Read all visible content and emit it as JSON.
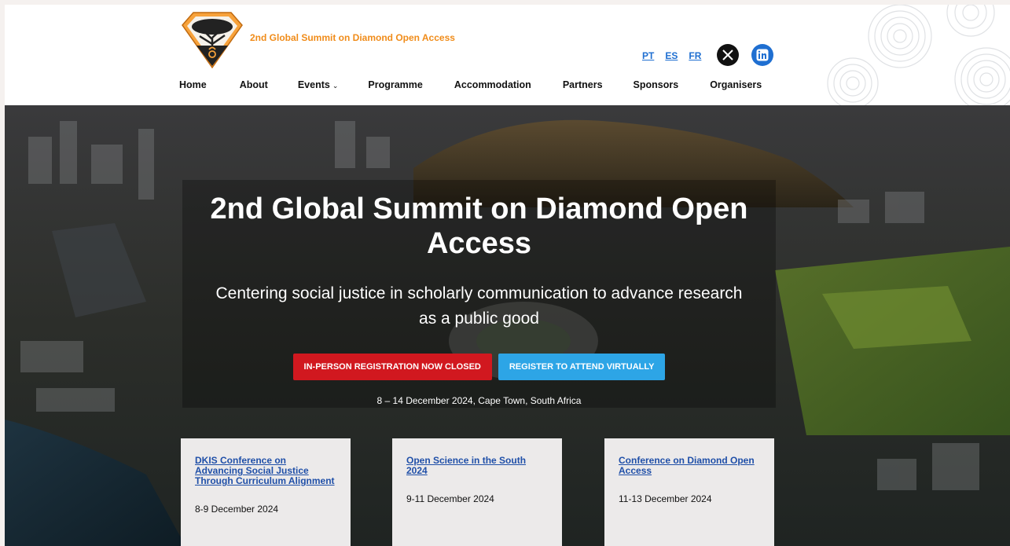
{
  "header": {
    "site_title": "2nd Global Summit on Diamond Open Access",
    "languages": [
      "PT",
      "ES",
      "FR"
    ],
    "social": {
      "x": "X",
      "linkedin": "in"
    }
  },
  "nav": {
    "items": [
      "Home",
      "About",
      "Events",
      "Programme",
      "Accommodation",
      "Partners",
      "Sponsors",
      "Organisers"
    ]
  },
  "hero": {
    "title": "2nd Global Summit on Diamond Open Access",
    "subtitle": "Centering social justice in scholarly communication to advance research as a public good",
    "btn_closed": "IN-PERSON REGISTRATION NOW CLOSED",
    "btn_virtual": "REGISTER TO ATTEND VIRTUALLY",
    "date_location": "8 – 14 December 2024, Cape Town, South Africa"
  },
  "events": [
    {
      "title": "DKIS Conference on Advancing Social Justice Through Curriculum Alignment",
      "date": "8-9 December 2024"
    },
    {
      "title": "Open Science in the South 2024",
      "date": "9-11 December 2024"
    },
    {
      "title": "Conference on Diamond Open Access",
      "date": "11-13 December 2024"
    }
  ],
  "colors": {
    "brand_orange": "#f08c1a",
    "link_blue": "#1f6fd1",
    "closed_red": "#d1181f",
    "virtual_blue": "#2da5e6"
  }
}
